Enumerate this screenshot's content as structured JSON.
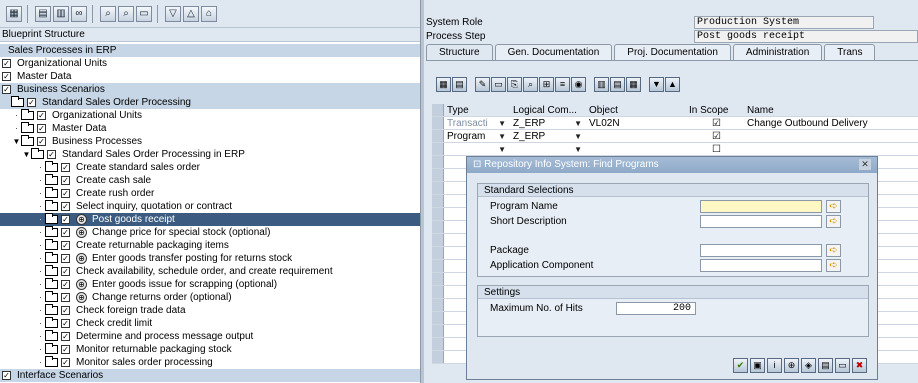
{
  "left": {
    "blueprint_header": "Blueprint Structure",
    "root_label": "Sales Processes in ERP",
    "tree": [
      {
        "label": "Organizational Units",
        "indent": 0,
        "check": true,
        "folder": false,
        "bg": "white"
      },
      {
        "label": "Master Data",
        "indent": 0,
        "check": true,
        "folder": false,
        "bg": "white"
      },
      {
        "label": "Business Scenarios",
        "indent": 0,
        "check": true,
        "folder": false,
        "bg": "blue"
      },
      {
        "label": "Standard Sales Order Processing",
        "indent": 0,
        "check": true,
        "folder": true,
        "bg": "blue"
      },
      {
        "label": "Organizational Units",
        "indent": 1,
        "check": true,
        "folder": true,
        "bg": "white"
      },
      {
        "label": "Master Data",
        "indent": 1,
        "check": true,
        "folder": true,
        "bg": "white"
      },
      {
        "label": "Business Processes",
        "indent": 1,
        "check": true,
        "folder": true,
        "bg": "white"
      },
      {
        "label": "Standard Sales Order Processing in ERP",
        "indent": 2,
        "check": true,
        "folder": true,
        "bg": "white"
      },
      {
        "label": "Create standard sales order",
        "indent": 3,
        "check": true,
        "folder": true,
        "proc": false,
        "bg": "white"
      },
      {
        "label": "Create cash sale",
        "indent": 3,
        "check": true,
        "folder": true,
        "proc": false,
        "bg": "white"
      },
      {
        "label": "Create rush order",
        "indent": 3,
        "check": true,
        "folder": true,
        "proc": false,
        "bg": "white"
      },
      {
        "label": "Select inquiry, quotation or contract",
        "indent": 3,
        "check": true,
        "folder": true,
        "proc": false,
        "bg": "white"
      },
      {
        "label": "Post goods receipt",
        "indent": 3,
        "check": true,
        "folder": true,
        "proc": true,
        "bg": "selected"
      },
      {
        "label": "Change price for special stock (optional)",
        "indent": 3,
        "check": true,
        "folder": true,
        "proc": true,
        "bg": "white"
      },
      {
        "label": "Create returnable packaging items",
        "indent": 3,
        "check": true,
        "folder": true,
        "proc": false,
        "bg": "white"
      },
      {
        "label": "Enter goods transfer posting for returns stock",
        "indent": 3,
        "check": true,
        "folder": true,
        "proc": true,
        "bg": "white"
      },
      {
        "label": "Check availability, schedule order, and create requirement",
        "indent": 3,
        "check": true,
        "folder": true,
        "proc": false,
        "bg": "white"
      },
      {
        "label": "Enter goods issue for scrapping (optional)",
        "indent": 3,
        "check": true,
        "folder": true,
        "proc": true,
        "bg": "white"
      },
      {
        "label": "Change returns order (optional)",
        "indent": 3,
        "check": true,
        "folder": true,
        "proc": true,
        "bg": "white"
      },
      {
        "label": "Check foreign trade data",
        "indent": 3,
        "check": true,
        "folder": true,
        "proc": false,
        "bg": "white"
      },
      {
        "label": "Check credit limit",
        "indent": 3,
        "check": true,
        "folder": true,
        "proc": false,
        "bg": "white"
      },
      {
        "label": "Determine and process message output",
        "indent": 3,
        "check": true,
        "folder": true,
        "proc": false,
        "bg": "white"
      },
      {
        "label": "Monitor returnable packaging stock",
        "indent": 3,
        "check": true,
        "folder": true,
        "proc": false,
        "bg": "white"
      },
      {
        "label": "Monitor sales order processing",
        "indent": 3,
        "check": true,
        "folder": true,
        "proc": false,
        "bg": "white"
      },
      {
        "label": "Interface Scenarios",
        "indent": 0,
        "check": true,
        "folder": false,
        "bg": "blue"
      }
    ]
  },
  "right": {
    "system_role_label": "System Role",
    "system_role_value": "Production System",
    "process_step_label": "Process Step",
    "process_step_value": "Post goods receipt",
    "tabs": [
      "Structure",
      "Gen. Documentation",
      "Proj. Documentation",
      "Administration",
      "Trans"
    ],
    "grid_headers": [
      "Type",
      "Logical Com...",
      "Object",
      "In Scope",
      "Name"
    ],
    "grid_rows": [
      {
        "type": "Transacti",
        "logical": "Z_ERP",
        "object": "VL02N",
        "in_scope": "☑",
        "name": "Change Outbound Delivery"
      },
      {
        "type": "Program",
        "logical": "Z_ERP",
        "object": "",
        "in_scope": "☑",
        "name": ""
      }
    ]
  },
  "dialog": {
    "title": "Repository Info System: Find Programs",
    "group1_title": "Standard Selections",
    "program_name_label": "Program Name",
    "short_desc_label": "Short Description",
    "package_label": "Package",
    "app_component_label": "Application Component",
    "group2_title": "Settings",
    "max_hits_label": "Maximum No. of Hits",
    "max_hits_value": "200"
  },
  "icons": {
    "toolbar_left": [
      "grid-icon",
      "page-icon",
      "page-copy-icon",
      "link-icon",
      "find-icon",
      "find-next-icon",
      "save-icon",
      "expand-icon",
      "collapse-icon",
      "lock-icon"
    ],
    "colors": {
      "selected": "#3b5c80",
      "accent_blue": "#c7d6e6"
    }
  }
}
